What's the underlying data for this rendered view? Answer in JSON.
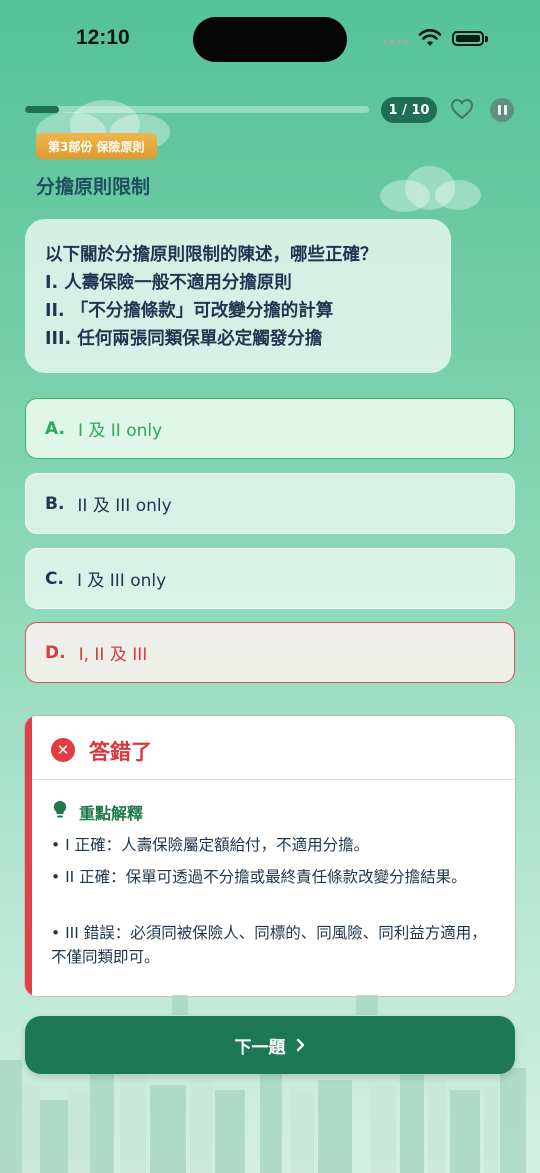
{
  "status_bar": {
    "time": "12:10"
  },
  "progress": {
    "fraction": 0.1,
    "counter": "1 / 10"
  },
  "header": {
    "part_badge": "第3部份 保險原則",
    "section_title": "分擔原則限制"
  },
  "question": {
    "lines": [
      "以下關於分擔原則限制的陳述，哪些正確？",
      "I. 人壽保險一般不適用分擔原則",
      "II. 「不分擔條款」可改變分擔的計算",
      "III. 任何兩張同類保單必定觸發分擔"
    ]
  },
  "options": [
    {
      "letter": "A.",
      "text": "I 及 II only",
      "state": "correct"
    },
    {
      "letter": "B.",
      "text": "II 及 III only",
      "state": "neutral"
    },
    {
      "letter": "C.",
      "text": "I 及 III only",
      "state": "neutral"
    },
    {
      "letter": "D.",
      "text": "I, II 及 III",
      "state": "wrong"
    }
  ],
  "feedback": {
    "title": "答錯了",
    "icon": "x-circle-icon",
    "explain_title": "重點解釋",
    "points": [
      "• I 正確：人壽保險屬定額給付，不適用分擔。",
      "• II 正確：保單可透過不分擔或最終責任條款改變分擔結果。",
      "• III 錯誤：必須同被保險人、同標的、同風險、同利益方適用，不僅同類即可。"
    ]
  },
  "next_button": {
    "label": "下一題",
    "icon": "chevron-right-icon"
  },
  "colors": {
    "accent": "#1c7855",
    "correct": "#2fa85c",
    "wrong": "#d63c44",
    "badge": "#e9a93a"
  }
}
